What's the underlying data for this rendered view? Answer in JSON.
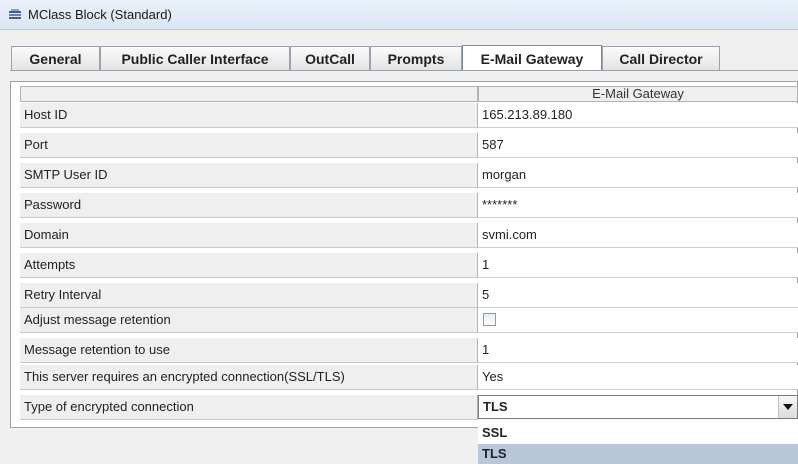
{
  "window": {
    "title": "MClass Block (Standard)"
  },
  "tabs": [
    {
      "label": "General"
    },
    {
      "label": "Public Caller Interface"
    },
    {
      "label": "OutCall"
    },
    {
      "label": "Prompts"
    },
    {
      "label": "E-Mail Gateway"
    },
    {
      "label": "Call Director"
    }
  ],
  "active_tab": "E-Mail Gateway",
  "table": {
    "column_header": "E-Mail Gateway",
    "rows": [
      {
        "label": "Host ID",
        "value": "165.213.89.180"
      },
      {
        "label": "Port",
        "value": "587"
      },
      {
        "label": "SMTP User ID",
        "value": "morgan"
      },
      {
        "label": "Password",
        "value": "*******"
      },
      {
        "label": "Domain",
        "value": "svmi.com"
      },
      {
        "label": "Attempts",
        "value": "1"
      },
      {
        "label": "Retry Interval",
        "value": "5"
      },
      {
        "label": "Adjust message retention",
        "value": ""
      },
      {
        "label": "Message retention to use",
        "value": "1"
      },
      {
        "label": "This server requires an encrypted connection(SSL/TLS)",
        "value": "Yes"
      },
      {
        "label": "Type of encrypted connection",
        "value": "TLS"
      }
    ]
  },
  "adjust_retention_checked": false,
  "encryption_dropdown": {
    "selected": "TLS",
    "options": [
      "SSL",
      "TLS"
    ]
  },
  "colors": {
    "selected_option_bg": "#b8c7da",
    "label_cell_bg": "#efefef"
  }
}
